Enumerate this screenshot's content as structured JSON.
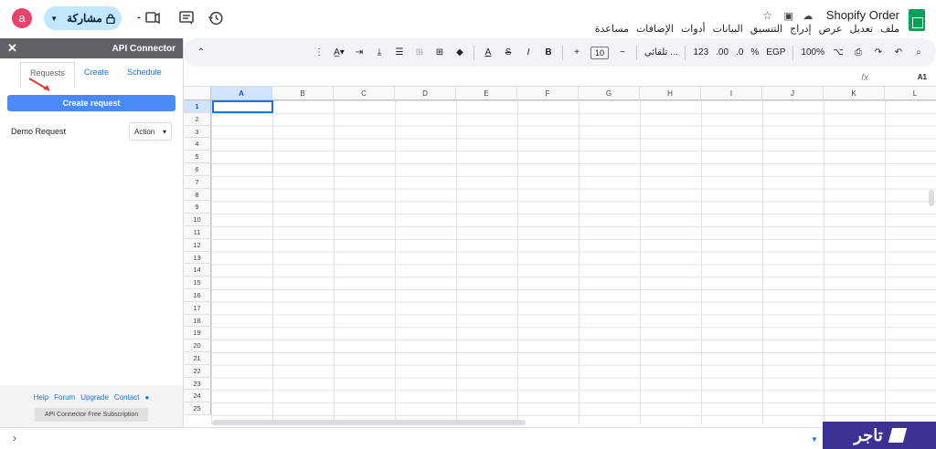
{
  "app": {
    "doc_title": "Shopify Order",
    "menu": [
      "ملف",
      "تعديل",
      "عرض",
      "إدراج",
      "التنسيق",
      "البيانات",
      "أدوات",
      "الإضافات",
      "مساعدة"
    ],
    "avatar_letter": "a",
    "share_label": "مشاركة"
  },
  "sidebar": {
    "title": "API Connector",
    "tabs": [
      "Requests",
      "Create",
      "Schedule"
    ],
    "create_button": "Create request",
    "request_name": "Demo Request",
    "action_label": "Action",
    "footer_links": [
      "Help",
      "Forum",
      "Upgrade",
      "Contact"
    ],
    "subscription": "API Connector Free Subscription"
  },
  "toolbar": {
    "zoom": "100%",
    "currency": "EGP",
    "percent": "%",
    "decimals_dec": ".0",
    "decimals_inc": ".00",
    "number_format": "123",
    "font": "تلقائي ...",
    "font_size": "10",
    "bold": "B",
    "italic": "I",
    "strike": "S",
    "text_color": "A"
  },
  "formula_bar": {
    "fx": "fx",
    "cell_ref": "A1"
  },
  "grid": {
    "columns": [
      "A",
      "B",
      "C",
      "D",
      "E",
      "F",
      "G",
      "H",
      "I",
      "J",
      "K",
      "L"
    ],
    "rows": [
      "1",
      "2",
      "3",
      "4",
      "5",
      "6",
      "7",
      "8",
      "9",
      "10",
      "11",
      "12",
      "13",
      "14",
      "15",
      "16",
      "17",
      "18",
      "19",
      "20",
      "21",
      "22",
      "23",
      "24",
      "25"
    ],
    "selected_column": "A",
    "selected_row": "1"
  },
  "brand": {
    "name": "تاجر"
  }
}
